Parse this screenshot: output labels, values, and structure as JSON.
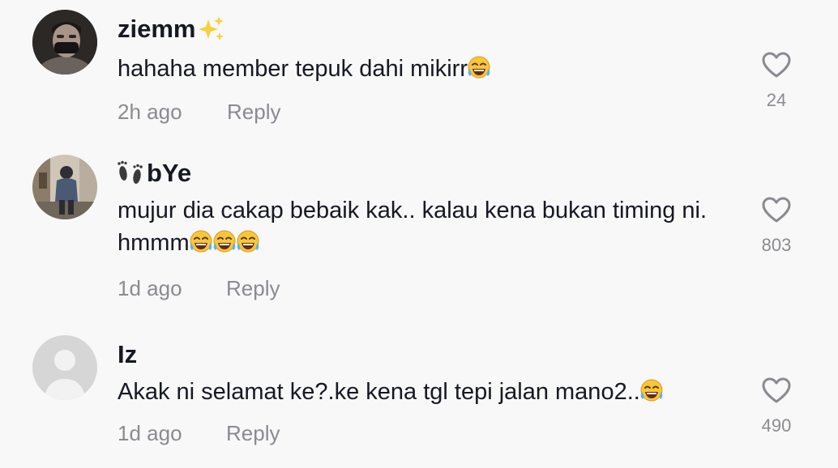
{
  "comments": [
    {
      "username": "ziemm",
      "username_suffix_icon": "sparkles-icon",
      "text": "hahaha member tepuk dahi mikirr",
      "text_emoji_count": 1,
      "time": "2h ago",
      "reply_label": "Reply",
      "likes": "24"
    },
    {
      "username": "bYe",
      "username_prefix_icon": "footprints-icon",
      "text": "mujur dia cakap bebaik kak.. kalau kena bukan timing ni. hmmm",
      "text_emoji_count": 3,
      "time": "1d ago",
      "reply_label": "Reply",
      "likes": "803"
    },
    {
      "username": "Iz",
      "text": "Akak ni selamat ke?.ke kena tgl tepi jalan mano2..",
      "text_emoji_count": 1,
      "time": "1d ago",
      "reply_label": "Reply",
      "likes": "490"
    }
  ],
  "colors": {
    "background": "#f8f8f8",
    "text_primary": "#161823",
    "text_secondary": "#8a8b91",
    "heart_outline": "#8a8b91",
    "emoji_face": "#f7c63a"
  }
}
